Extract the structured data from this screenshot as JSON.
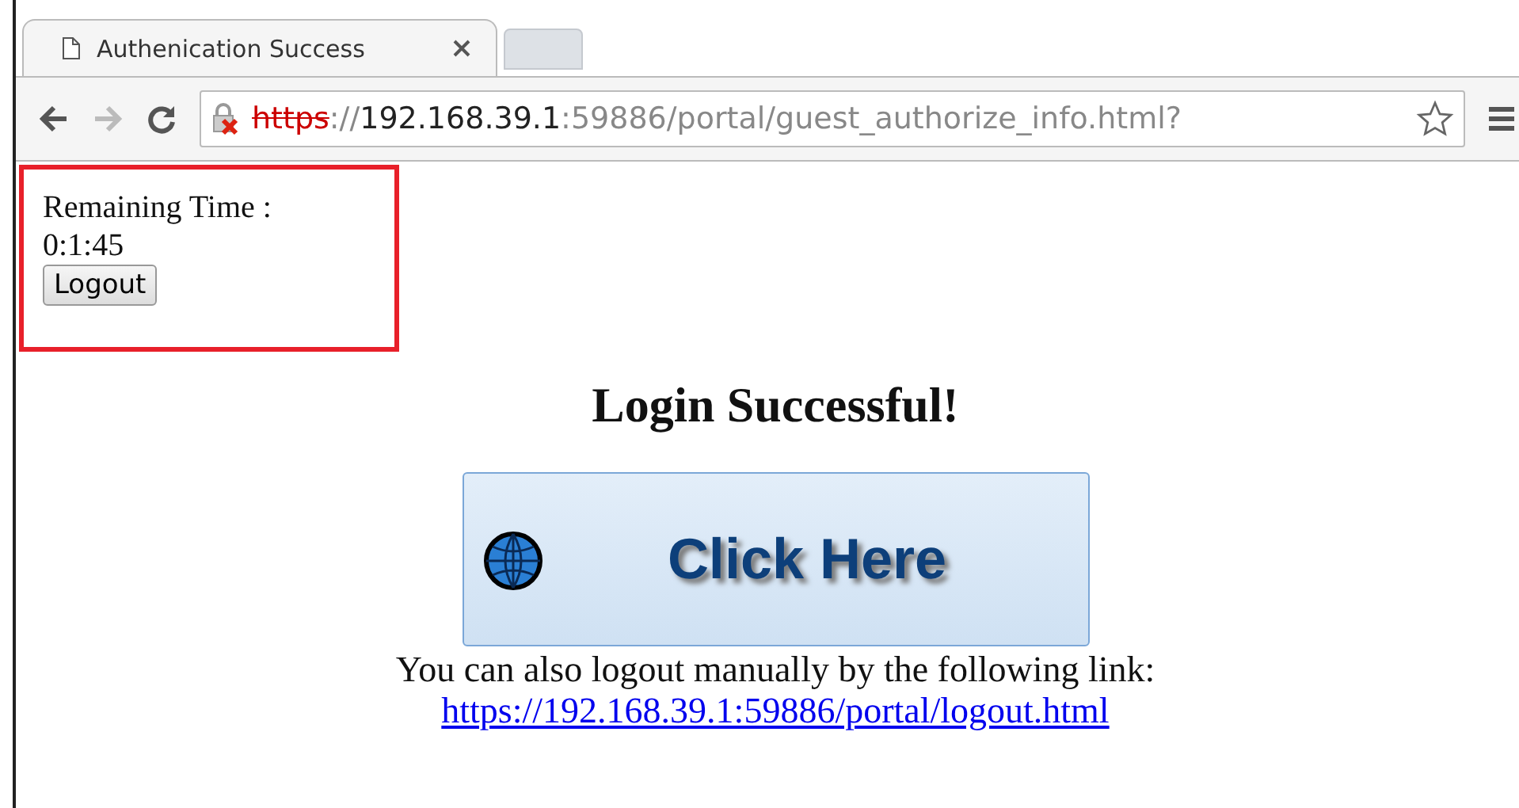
{
  "tabs": [
    {
      "title": "Authenication Success",
      "selected": true
    }
  ],
  "address_bar": {
    "scheme": "https",
    "separator": "://",
    "host": "192.168.39.1",
    "rest": ":59886/portal/guest_authorize_info.html?",
    "insecure": true
  },
  "session_box": {
    "label": "Remaining Time :",
    "time": "0:1:45",
    "button": "Logout"
  },
  "heading": "Login Successful!",
  "click_button": "Click Here",
  "note": "You can also logout manually by the following link:",
  "logout_link": "https://192.168.39.1:59886/portal/logout.html"
}
